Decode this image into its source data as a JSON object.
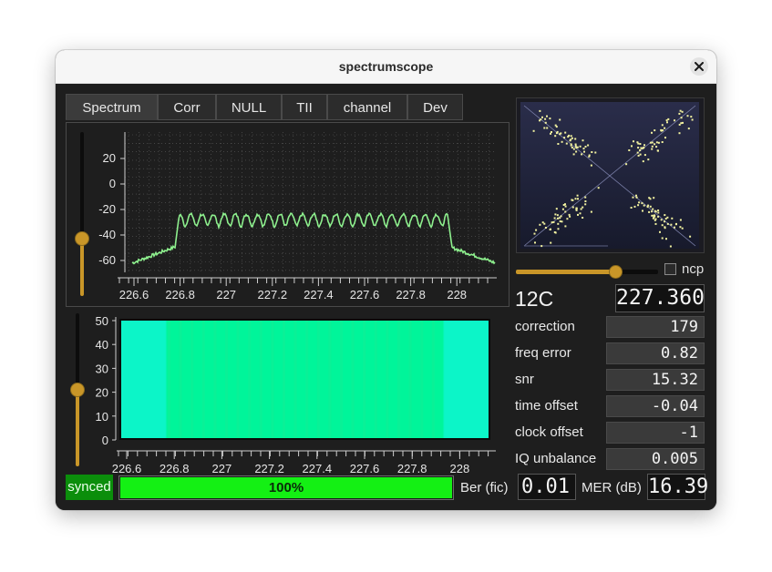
{
  "window": {
    "title": "spectrumscope"
  },
  "tabs": [
    "Spectrum",
    "Corr",
    "NULL",
    "TII",
    "channel",
    "Dev"
  ],
  "active_tab": "Spectrum",
  "spectrum": {
    "y_ticks": [
      "20",
      "0",
      "-20",
      "-40",
      "-60"
    ],
    "x_ticks": [
      "226.6",
      "226.8",
      "227",
      "227.2",
      "227.4",
      "227.6",
      "227.8",
      "228"
    ],
    "line_color": "#8ef08e",
    "slider_level": 0.35
  },
  "waterfall": {
    "y_ticks": [
      "50",
      "40",
      "30",
      "20",
      "10",
      "0"
    ],
    "x_ticks": [
      "226.6",
      "226.8",
      "227",
      "227.2",
      "227.4",
      "227.6",
      "227.8",
      "228"
    ],
    "edge_color": "#0cf5c8",
    "band_color": "#00f59a",
    "slider_level": 0.5
  },
  "constellation": {
    "point_color": "#f2f2a0",
    "slider_level": 0.7
  },
  "ncp": {
    "label": "ncp",
    "checked": false
  },
  "channel": {
    "name": "12C",
    "frequency": "227.360"
  },
  "stats": [
    {
      "label": "correction",
      "value": "179"
    },
    {
      "label": "freq error",
      "value": "0.82"
    },
    {
      "label": "snr",
      "value": "15.32"
    },
    {
      "label": "time offset",
      "value": "-0.04"
    },
    {
      "label": "clock offset",
      "value": "-1"
    },
    {
      "label": "IQ unbalance",
      "value": "0.005"
    }
  ],
  "status": {
    "synced_label": "synced",
    "progress_text": "100%",
    "progress": 1.0,
    "ber_label": "Ber (fic)",
    "ber_value": "0.01",
    "mer_label": "MER (dB)",
    "mer_value": "16.39"
  }
}
